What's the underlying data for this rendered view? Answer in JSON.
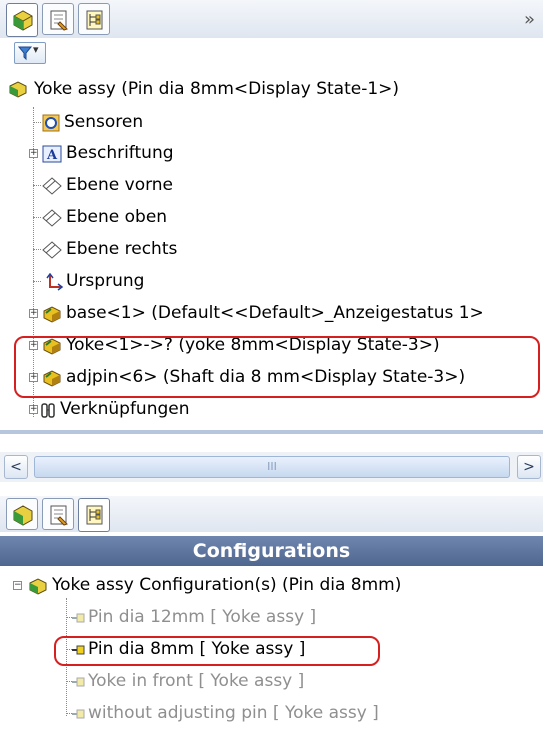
{
  "top_tabs": [
    {
      "name": "feature-manager",
      "icon": "assembly-icon",
      "active": true
    },
    {
      "name": "property-manager",
      "icon": "property-icon",
      "active": false
    },
    {
      "name": "configuration-manager",
      "icon": "configuration-icon",
      "active": false
    }
  ],
  "more_glyph": "»",
  "filter_glyph": "▾",
  "tree": {
    "root": "Yoke assy  (Pin dia 8mm<Display State-1>)",
    "items": [
      {
        "label": "Sensoren",
        "icon": "sensor-icon",
        "expandable": false
      },
      {
        "label": "Beschriftung",
        "icon": "annotation-icon",
        "expandable": true
      },
      {
        "label": "Ebene vorne",
        "icon": "plane-icon",
        "expandable": false
      },
      {
        "label": "Ebene oben",
        "icon": "plane-icon",
        "expandable": false
      },
      {
        "label": "Ebene rechts",
        "icon": "plane-icon",
        "expandable": false
      },
      {
        "label": "Ursprung",
        "icon": "origin-icon",
        "expandable": false
      },
      {
        "label": "base<1> (Default<<Default>_Anzeigestatus 1>",
        "icon": "part-icon",
        "expandable": true
      },
      {
        "label": "Yoke<1>->? (yoke 8mm<Display State-3>)",
        "icon": "part-icon",
        "expandable": true,
        "highlighted": true
      },
      {
        "label": "adjpin<6> (Shaft dia 8 mm<Display State-3>)",
        "icon": "part-icon",
        "expandable": true,
        "highlighted": true
      },
      {
        "label": "Verknüpfungen",
        "icon": "mates-icon",
        "expandable": true
      }
    ]
  },
  "scrollbar": {
    "thumb_grip": "III",
    "left_arrow": "<",
    "right_arrow": ">"
  },
  "configurations": {
    "header": "Configurations",
    "root": "Yoke assy Configuration(s)  (Pin dia 8mm)",
    "items": [
      {
        "label": "Pin dia 12mm [ Yoke assy ]",
        "active": false
      },
      {
        "label": "Pin dia 8mm [ Yoke assy ]",
        "active": true,
        "highlighted": true
      },
      {
        "label": "Yoke in front [ Yoke assy ]",
        "active": false
      },
      {
        "label": "without adjusting pin [ Yoke assy ]",
        "active": false
      }
    ]
  },
  "colors": {
    "highlight": "#d62020",
    "header_bg": "#5a7098",
    "inactive_text": "#8f8f8f"
  }
}
